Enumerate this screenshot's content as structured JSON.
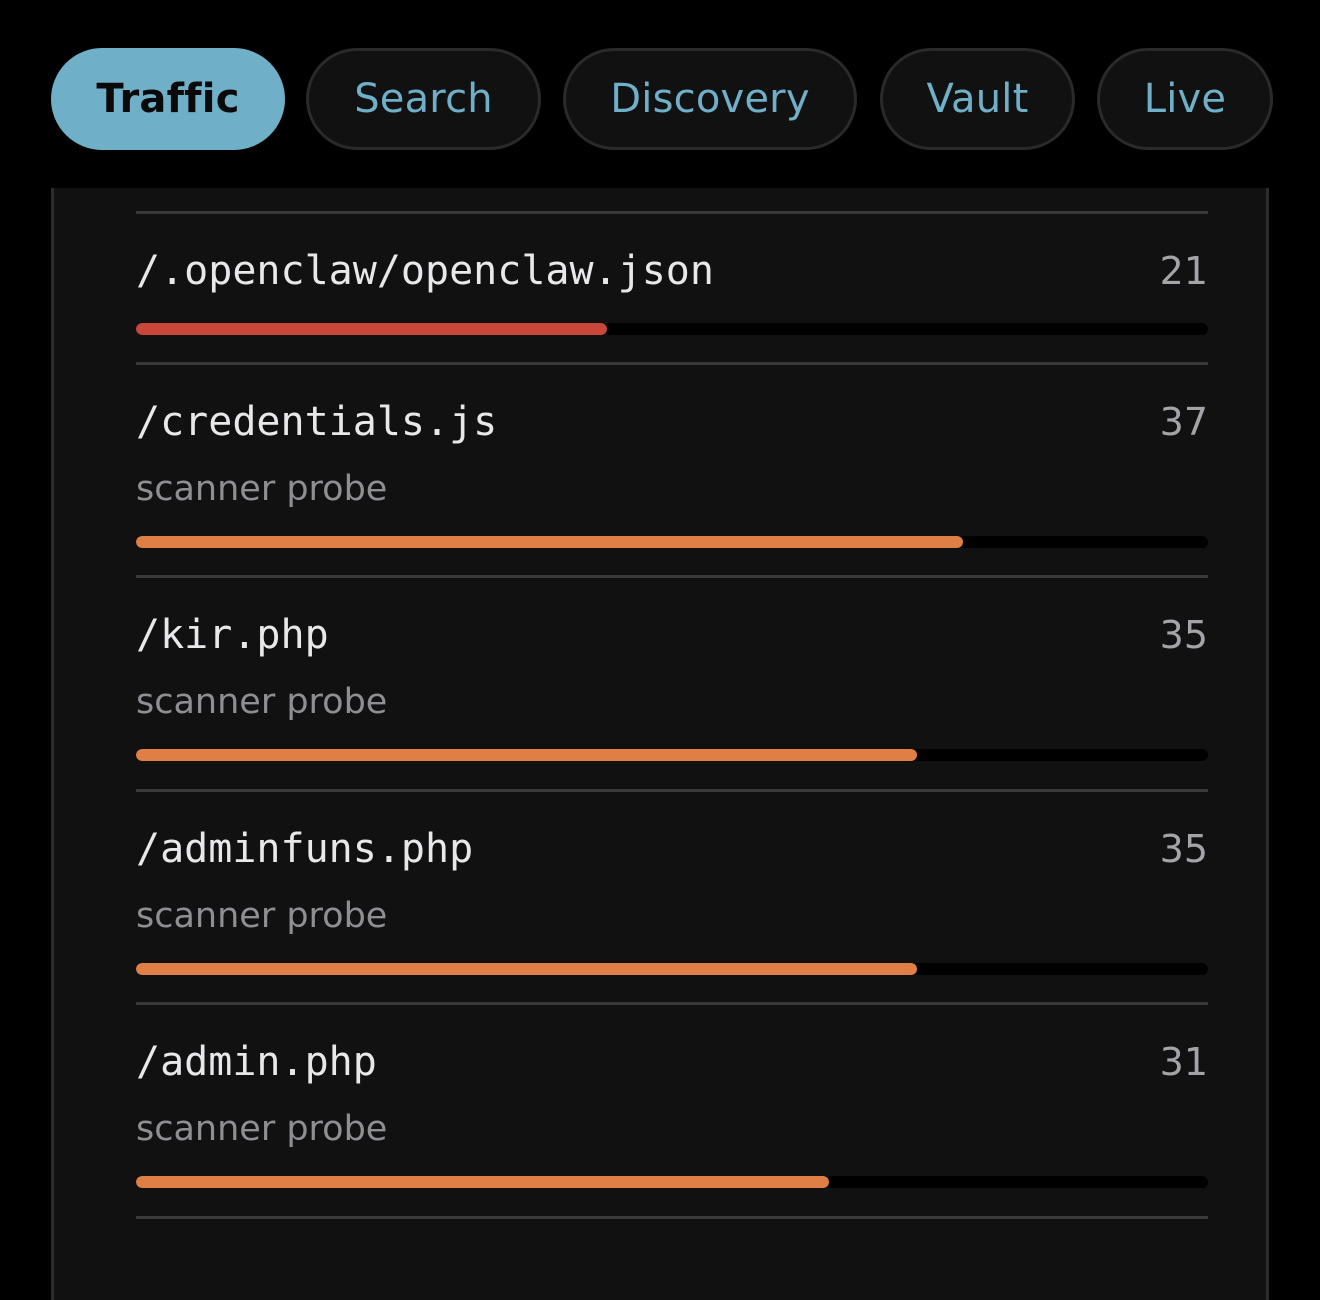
{
  "tabs": [
    {
      "label": "Traffic",
      "active": true
    },
    {
      "label": "Search",
      "active": false
    },
    {
      "label": "Discovery",
      "active": false
    },
    {
      "label": "Vault",
      "active": false
    },
    {
      "label": "Live",
      "active": false
    }
  ],
  "colors": {
    "accent": "#6fb0c8",
    "bar_red": "#c8463a",
    "bar_orange": "#e07f45",
    "background": "#000000",
    "card": "#111112"
  },
  "paths": [
    {
      "path": "/.openclaw/openclaw.json",
      "count": "21",
      "label": "",
      "fraction": 0.439,
      "color": "#c8463a"
    },
    {
      "path": "/credentials.js",
      "count": "37",
      "label": "scanner probe",
      "fraction": 0.771,
      "color": "#e07f45"
    },
    {
      "path": "/kir.php",
      "count": "35",
      "label": "scanner probe",
      "fraction": 0.729,
      "color": "#e07f45"
    },
    {
      "path": "/adminfuns.php",
      "count": "35",
      "label": "scanner probe",
      "fraction": 0.729,
      "color": "#e07f45"
    },
    {
      "path": "/admin.php",
      "count": "31",
      "label": "scanner probe",
      "fraction": 0.646,
      "color": "#e07f45"
    }
  ]
}
